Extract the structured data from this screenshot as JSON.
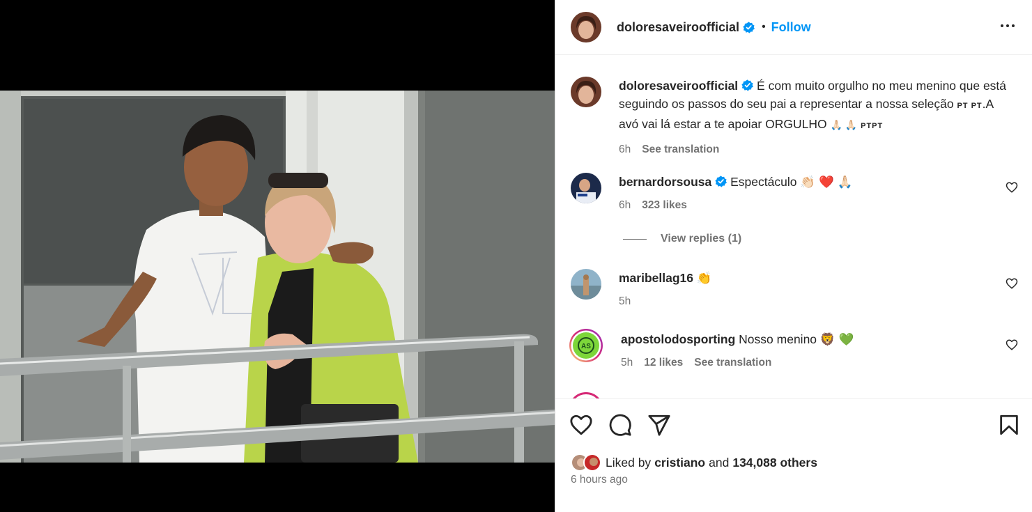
{
  "post": {
    "username": "doloresaveiroofficial",
    "follow_label": "Follow",
    "dot": "•"
  },
  "caption": {
    "username": "doloresaveiroofficial",
    "text_part1": "É com muito orgulho no meu menino que está seguindo os passos do seu pai a representar a nossa seleção ",
    "flag1": "PT PT",
    "text_part2": ".A avó vai lá estar a te apoiar ORGULHO ",
    "emoji": "🙏🏻 🙏🏻",
    "flag2": "PTPT",
    "time": "6h",
    "see_translation": "See translation"
  },
  "comments": [
    {
      "username": "bernardorsousa",
      "verified": true,
      "text": "Espectáculo",
      "emoji": "👏🏻 ❤️ 🙏🏻",
      "time": "6h",
      "likes": "323 likes",
      "extra": ""
    },
    {
      "username": "maribellag16",
      "verified": false,
      "text": "",
      "emoji": "👏",
      "time": "5h",
      "likes": "",
      "extra": ""
    },
    {
      "username": "apostolodosporting",
      "verified": false,
      "text": "Nosso menino",
      "emoji": "🦁 💚",
      "time": "5h",
      "likes": "12 likes",
      "extra": "See translation"
    }
  ],
  "view_replies": "View replies (1)",
  "likes_bar": {
    "prefix": "Liked by ",
    "user": "cristiano",
    "middle": " and ",
    "count": "134,088 others"
  },
  "timestamp": "6 hours ago",
  "icons": {
    "more": "more-options-icon",
    "like": "heart-icon",
    "comment": "comment-icon",
    "share": "share-icon",
    "save": "bookmark-icon"
  },
  "colors": {
    "link_blue": "#0095f6",
    "verified_blue": "#0095f6",
    "text_primary": "#262626",
    "text_secondary": "#737373"
  }
}
